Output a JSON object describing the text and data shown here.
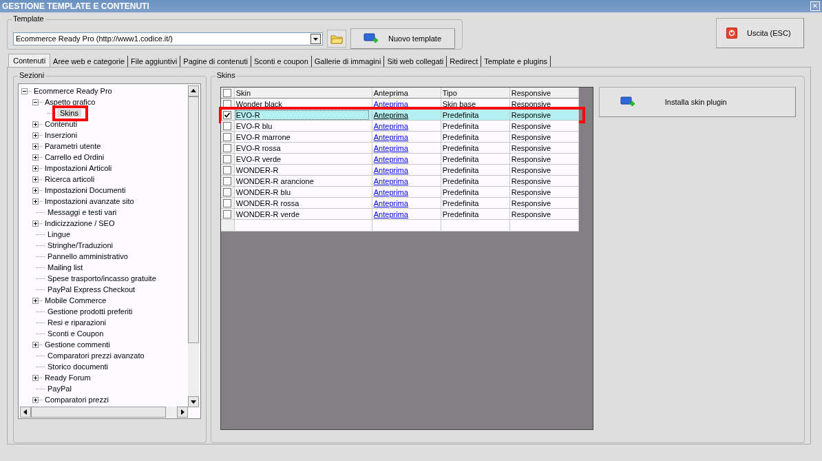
{
  "window": {
    "title": "GESTIONE TEMPLATE E CONTENUTI",
    "close": "✕"
  },
  "template": {
    "legend": "Template",
    "value": "Ecommerce Ready Pro (http://www1.codice.it/)",
    "new_button": "Nuovo template"
  },
  "exit_button": "Uscita (ESC)",
  "tabs": [
    {
      "label": "Contenuti",
      "selected": true
    },
    {
      "label": "Aree web e categorie",
      "selected": false
    },
    {
      "label": "File aggiuntivi",
      "selected": false
    },
    {
      "label": "Pagine di contenuti",
      "selected": false
    },
    {
      "label": "Sconti e coupon",
      "selected": false
    },
    {
      "label": "Gallerie di immagini",
      "selected": false
    },
    {
      "label": "Siti web collegati",
      "selected": false
    },
    {
      "label": "Redirect",
      "selected": false
    },
    {
      "label": "Template e plugins",
      "selected": false
    }
  ],
  "sections": {
    "legend": "Sezioni",
    "tree": [
      {
        "label": "Ecommerce Ready Pro",
        "expanded": true,
        "children": [
          {
            "label": "Aspetto grafico",
            "expanded": true,
            "children": [
              {
                "label": "Skins",
                "selected": true,
                "highlighted": true
              }
            ]
          },
          {
            "label": "Contenuti",
            "expanded": false
          },
          {
            "label": "Inserzioni",
            "expanded": false
          },
          {
            "label": "Parametri utente",
            "expanded": false
          },
          {
            "label": "Carrello ed Ordini",
            "expanded": false
          },
          {
            "label": "Impostazioni Articoli",
            "expanded": false
          },
          {
            "label": "Ricerca articoli",
            "expanded": false
          },
          {
            "label": "Impostazioni Documenti",
            "expanded": false
          },
          {
            "label": "Impostazioni avanzate sito",
            "expanded": false
          },
          {
            "label": "Messaggi e testi vari"
          },
          {
            "label": "Indicizzazione / SEO",
            "expanded": false
          },
          {
            "label": "Lingue"
          },
          {
            "label": "Stringhe/Traduzioni"
          },
          {
            "label": "Pannello amministrativo"
          },
          {
            "label": "Mailing list"
          },
          {
            "label": "Spese trasporto/incasso gratuite"
          },
          {
            "label": "PayPal Express Checkout"
          },
          {
            "label": "Mobile Commerce",
            "expanded": false
          },
          {
            "label": "Gestione prodotti preferiti"
          },
          {
            "label": "Resi e riparazioni"
          },
          {
            "label": "Sconti e Coupon"
          },
          {
            "label": "Gestione commenti",
            "expanded": false
          },
          {
            "label": "Comparatori prezzi avanzato"
          },
          {
            "label": "Storico documenti"
          },
          {
            "label": "Ready Forum",
            "expanded": false
          },
          {
            "label": "PayPal"
          },
          {
            "label": "Comparatori prezzi",
            "expanded": false
          }
        ]
      }
    ]
  },
  "skins": {
    "legend": "Skins",
    "header_checked": false,
    "columns": [
      "Skin",
      "Anteprima",
      "Tipo",
      "Responsive"
    ],
    "rows": [
      {
        "checked": false,
        "selected": false,
        "highlighted": false,
        "skin": "Wonder black",
        "preview": "Anteprima",
        "type": "Skin base",
        "responsive": "Responsive"
      },
      {
        "checked": true,
        "selected": true,
        "highlighted": true,
        "skin": "EVO-R",
        "preview": "Anteprima",
        "type": "Predefinita",
        "responsive": "Responsive"
      },
      {
        "checked": false,
        "selected": false,
        "highlighted": false,
        "skin": "EVO-R blu",
        "preview": "Anteprima",
        "type": "Predefinita",
        "responsive": "Responsive"
      },
      {
        "checked": false,
        "selected": false,
        "highlighted": false,
        "skin": "EVO-R marrone",
        "preview": "Anteprima",
        "type": "Predefinita",
        "responsive": "Responsive"
      },
      {
        "checked": false,
        "selected": false,
        "highlighted": false,
        "skin": "EVO-R rossa",
        "preview": "Anteprima",
        "type": "Predefinita",
        "responsive": "Responsive"
      },
      {
        "checked": false,
        "selected": false,
        "highlighted": false,
        "skin": "EVO-R verde",
        "preview": "Anteprima",
        "type": "Predefinita",
        "responsive": "Responsive"
      },
      {
        "checked": false,
        "selected": false,
        "highlighted": false,
        "skin": "WONDER-R",
        "preview": "Anteprima",
        "type": "Predefinita",
        "responsive": "Responsive"
      },
      {
        "checked": false,
        "selected": false,
        "highlighted": false,
        "skin": "WONDER-R arancione",
        "preview": "Anteprima",
        "type": "Predefinita",
        "responsive": "Responsive"
      },
      {
        "checked": false,
        "selected": false,
        "highlighted": false,
        "skin": "WONDER-R blu",
        "preview": "Anteprima",
        "type": "Predefinita",
        "responsive": "Responsive"
      },
      {
        "checked": false,
        "selected": false,
        "highlighted": false,
        "skin": "WONDER-R rossa",
        "preview": "Anteprima",
        "type": "Predefinita",
        "responsive": "Responsive"
      },
      {
        "checked": false,
        "selected": false,
        "highlighted": false,
        "skin": "WONDER-R verde",
        "preview": "Anteprima",
        "type": "Predefinita",
        "responsive": "Responsive"
      }
    ],
    "install_button": "Installa skin plugin"
  }
}
